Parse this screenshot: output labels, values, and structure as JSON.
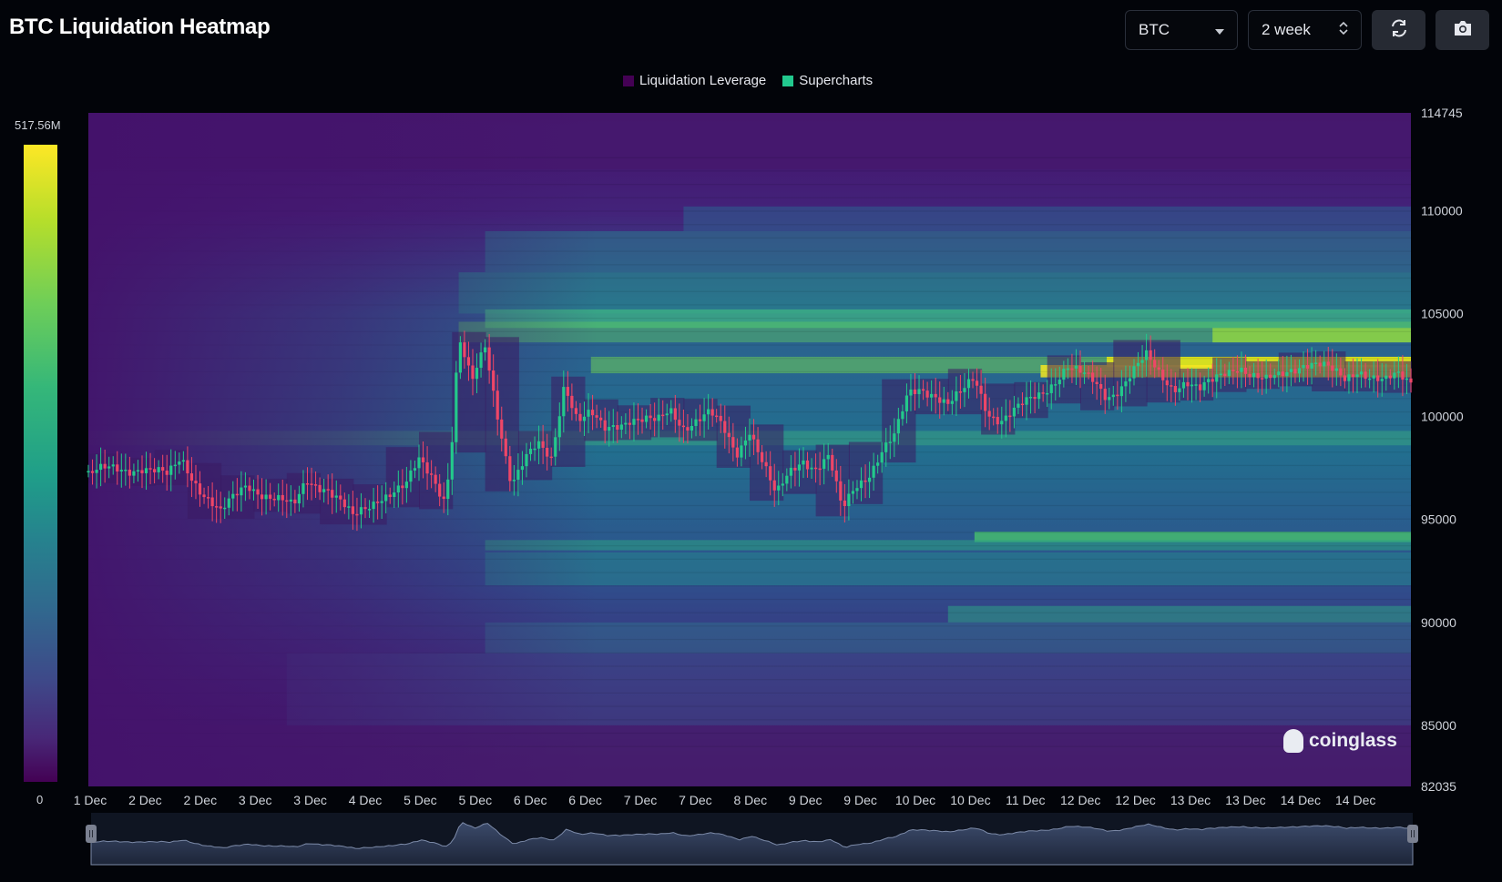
{
  "header": {
    "title": "BTC Liquidation Heatmap",
    "symbol_select": "BTC",
    "period_select": "2 week",
    "refresh_icon": "refresh-icon",
    "camera_icon": "camera-icon"
  },
  "legend": [
    {
      "label": "Liquidation Leverage",
      "color": "#440154"
    },
    {
      "label": "Supercharts",
      "color": "#22c98e"
    }
  ],
  "colorbar": {
    "max_label": "517.56M",
    "min_label": "0"
  },
  "watermark": "coinglass",
  "chart_data": {
    "type": "heatmap",
    "title": "BTC Liquidation Heatmap",
    "ylim": [
      82035,
      114745
    ],
    "y_ticks": [
      "114745",
      "110000",
      "105000",
      "100000",
      "95000",
      "90000",
      "85000",
      "82035"
    ],
    "x_ticks": [
      "1 Dec",
      "2 Dec",
      "2 Dec",
      "3 Dec",
      "3 Dec",
      "4 Dec",
      "5 Dec",
      "5 Dec",
      "6 Dec",
      "6 Dec",
      "7 Dec",
      "7 Dec",
      "8 Dec",
      "9 Dec",
      "9 Dec",
      "10 Dec",
      "10 Dec",
      "11 Dec",
      "12 Dec",
      "12 Dec",
      "13 Dec",
      "13 Dec",
      "14 Dec",
      "14 Dec"
    ],
    "colorscale": {
      "min": 0,
      "max": 517560000,
      "min_label": "0",
      "max_label": "517.56M"
    },
    "price_series": {
      "name": "BTC price",
      "t": [
        0,
        0.04,
        0.06,
        0.07,
        0.085,
        0.1,
        0.12,
        0.14,
        0.155,
        0.165,
        0.18,
        0.2,
        0.22,
        0.24,
        0.25,
        0.26,
        0.27,
        0.275,
        0.28,
        0.29,
        0.3,
        0.31,
        0.32,
        0.33,
        0.34,
        0.35,
        0.36,
        0.37,
        0.38,
        0.39,
        0.4,
        0.41,
        0.42,
        0.43,
        0.44,
        0.45,
        0.46,
        0.47,
        0.48,
        0.49,
        0.5,
        0.51,
        0.52,
        0.53,
        0.54,
        0.55,
        0.56,
        0.57,
        0.58,
        0.59,
        0.6,
        0.61,
        0.62,
        0.63,
        0.64,
        0.65,
        0.66,
        0.67,
        0.68,
        0.69,
        0.7,
        0.71,
        0.72,
        0.73,
        0.74,
        0.75,
        0.76,
        0.77,
        0.78,
        0.79,
        0.8,
        0.81,
        0.82,
        0.83,
        0.84,
        0.85,
        0.86,
        0.87,
        0.88,
        0.89,
        0.9,
        0.91,
        0.92,
        0.93,
        0.94,
        0.95,
        0.96,
        0.97,
        0.98,
        0.99,
        1.0
      ],
      "price": [
        97200,
        97600,
        97000,
        98000,
        96500,
        95200,
        96800,
        96000,
        95500,
        97000,
        96600,
        95000,
        96200,
        96500,
        97800,
        97200,
        96000,
        99000,
        103800,
        101500,
        103400,
        100000,
        96800,
        97800,
        98500,
        98000,
        101800,
        99800,
        100000,
        99300,
        99700,
        100000,
        99800,
        99600,
        100300,
        99600,
        99900,
        100100,
        99300,
        98200,
        99500,
        97800,
        96000,
        97200,
        98000,
        97600,
        98000,
        95300,
        96600,
        97300,
        98400,
        99000,
        101000,
        101400,
        101200,
        100600,
        101000,
        101800,
        100300,
        99900,
        100200,
        100600,
        101100,
        101800,
        102500,
        102000,
        101600,
        101000,
        101500,
        102200,
        102800,
        102000,
        101500,
        101800,
        101200,
        101600,
        102200,
        102600,
        102000,
        101600,
        101900,
        102400,
        102700,
        102500,
        102100,
        101800,
        102400,
        102000,
        101600,
        101900,
        101700
      ]
    }
  }
}
